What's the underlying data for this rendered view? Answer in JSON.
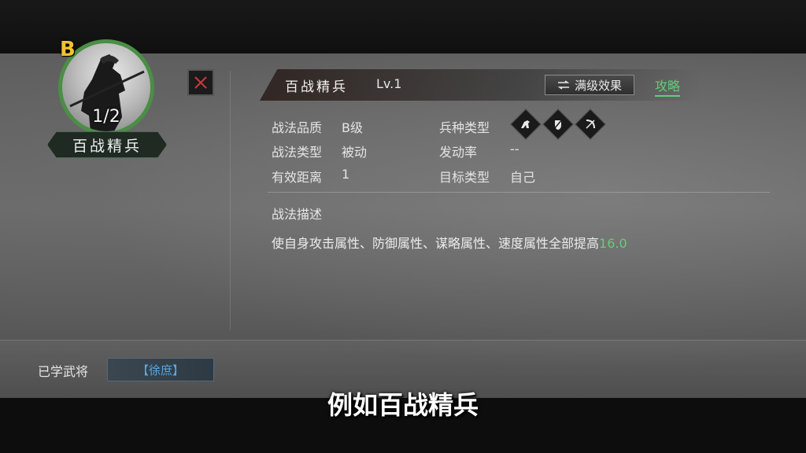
{
  "skill": {
    "grade": "B",
    "count": "1/2",
    "name_plate": "百战精兵",
    "title": "百战精兵",
    "level": "Lv.1",
    "max_effect_label": "满级效果",
    "guide_label": "攻略"
  },
  "details": {
    "quality_label": "战法品质",
    "quality_value": "B级",
    "type_label": "战法类型",
    "type_value": "被动",
    "range_label": "有效距离",
    "range_value": "1",
    "troop_label": "兵种类型",
    "troop_icons": [
      "cavalry-icon",
      "shield-icon",
      "bow-icon"
    ],
    "rate_label": "发动率",
    "rate_value": "--",
    "target_label": "目标类型",
    "target_value": "自己"
  },
  "description": {
    "title": "战法描述",
    "text": "使自身攻击属性、防御属性、谋略属性、速度属性全部提高",
    "value": "16.0"
  },
  "learned": {
    "label": "已学武将",
    "general": "【徐庶】"
  },
  "subtitle": "例如百战精兵",
  "colors": {
    "accent_green": "#5fcf7b",
    "grade_gold": "#f1c233",
    "general_blue": "#5ea8e0",
    "close_red": "#d23a3a"
  }
}
